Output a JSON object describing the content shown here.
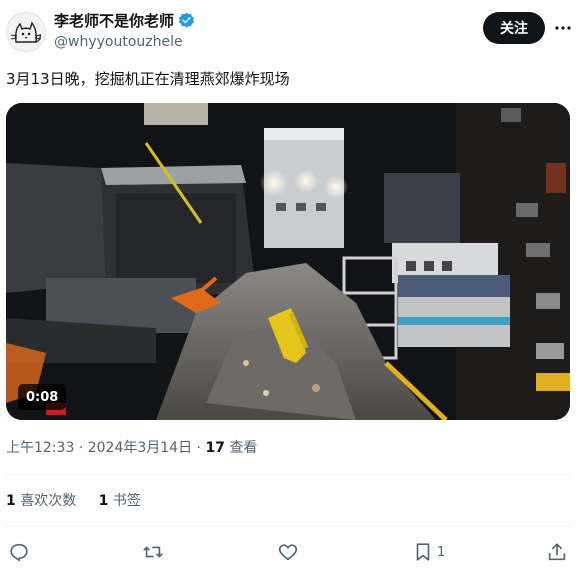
{
  "author": {
    "display_name": "李老师不是你老师",
    "handle": "@whyyoutouzhele",
    "follow_label": "关注"
  },
  "tweet": {
    "text": "3月13日晚，挖掘机正在清理燕郊爆炸现场",
    "media": {
      "duration": "0:08"
    },
    "time": "上午12:33",
    "date": "2024年3月14日",
    "separator": "·",
    "views_count": "17",
    "views_label": "查看"
  },
  "stats": {
    "likes_count": "1",
    "likes_label": "喜欢次数",
    "bookmarks_count": "1",
    "bookmarks_label": "书签"
  },
  "actions": {
    "bookmark_count": "1"
  },
  "colors": {
    "text_primary": "#0f1419",
    "text_secondary": "#536471",
    "verified_blue": "#1d9bf0",
    "follow_button_bg": "#0f1419",
    "divider": "#eff3f4"
  },
  "icons": [
    "cat-sketch-avatar",
    "verified-badge-icon",
    "more-dots-icon",
    "reply-icon",
    "retweet-icon",
    "like-icon",
    "bookmark-icon",
    "share-icon"
  ]
}
